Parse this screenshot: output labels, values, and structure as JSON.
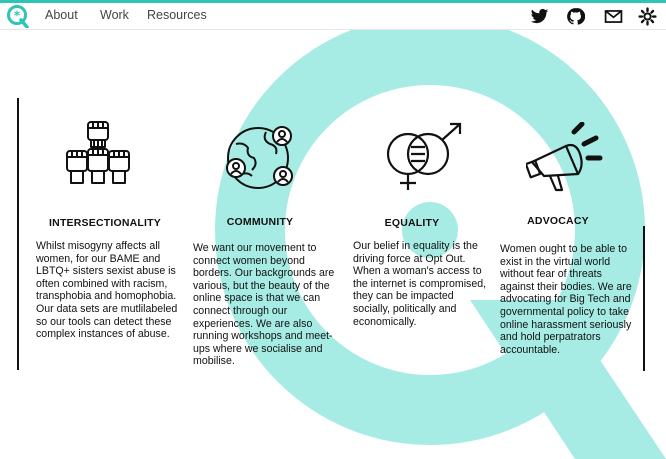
{
  "nav": {
    "links": [
      "About",
      "Work",
      "Resources"
    ],
    "icons": [
      "twitter-icon",
      "github-icon",
      "mail-icon",
      "settings-icon"
    ]
  },
  "accent_color": "#2ec4b6",
  "columns": [
    {
      "title": "INTERSECTIONALITY",
      "icon": "raised-fists-icon",
      "paragraphs": [
        "Whilst misogyny affects all women, for our BAME and LBTQ+ sisters sexist abuse is often combined with racism, transphobia and homophobia.",
        "Our data sets are mutlilabeled so our tools can detect these complex instances of abuse."
      ]
    },
    {
      "title": "COMMUNITY",
      "icon": "globe-people-icon",
      "paragraphs": [
        "We want our movement to connect women beyond borders. Our backgrounds are various, but the beauty of the online space is that we can connect through our experiences. We are also running workshops and meet-ups where we socialise and mobilise."
      ]
    },
    {
      "title": "EQUALITY",
      "icon": "gender-equality-icon",
      "paragraphs": [
        "Our belief in equality is the driving force at Opt Out. When a woman's access to the internet is compromised, they can be impacted socially, politically and economically."
      ]
    },
    {
      "title": "ADVOCACY",
      "icon": "megaphone-icon",
      "paragraphs": [
        "Women ought to be able to exist in the virtual world without fear of threats against their bodies. We are advocating for Big Tech and governmental policy to take online harassment seriously and hold perpatrators accountable."
      ]
    }
  ]
}
